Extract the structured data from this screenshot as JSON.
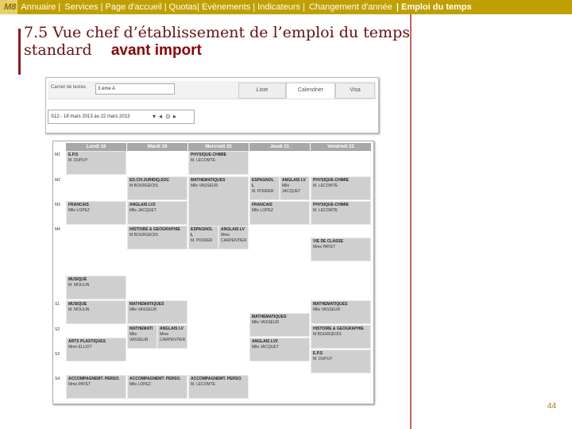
{
  "nav": {
    "badge": "M8",
    "items": [
      "Annuaire |",
      "Services | Page d'accueil | Quotas| Evènements | Indicateurs |",
      "Changement d'année",
      "| Emploi du temps"
    ]
  },
  "title": {
    "line1": "7.5 Vue chef d’établissement de l’emploi du temps",
    "line2": "standard",
    "highlight": "avant import"
  },
  "screenshot1": {
    "label": "Carnet de textes",
    "select": "3 ème A",
    "tabs": [
      "Liste",
      "Calendrier",
      "Visa"
    ],
    "active_tab": "Calendrier",
    "week": "S12 - 18 mars 2013 au 22 mars 2013"
  },
  "screenshot2": {
    "days": [
      "Lundi 18",
      "Mardi 19",
      "Mercredi 20",
      "Jeudi 21",
      "Vendredi 22"
    ],
    "hours": [
      "M1",
      "M2",
      "M3",
      "M4",
      "S1",
      "S2",
      "S3",
      "S4"
    ],
    "cells": [
      {
        "subject": "E.P.S",
        "teacher": "M. DUPUY"
      },
      {
        "subject": "PHYSIQUE-CHIMIE",
        "teacher": "M. LECOMTE"
      },
      {
        "subject": "ED.CIV.JURIDIQ.SOC",
        "teacher": "M BOURGEOIS"
      },
      {
        "subject": "MATHEMATIQUES",
        "teacher": "Mlle VASSEUR"
      },
      {
        "subject": "ESPAGNOL L",
        "teacher": "M. POIRIER"
      },
      {
        "subject": "ANGLAIS LV",
        "teacher": "Mlle JACQUET"
      },
      {
        "subject": "PHYSIQUE-CHIMIE",
        "teacher": "M. LECOMTE"
      },
      {
        "subject": "FRANCAIS",
        "teacher": "Mlle LOPEZ"
      },
      {
        "subject": "ANGLAIS LV2",
        "teacher": "Mlle JACQUET"
      },
      {
        "subject": "FRANCAIS",
        "teacher": "Mlle LOPEZ"
      },
      {
        "subject": "PHYSIQUE-CHIMIE",
        "teacher": "M. LECOMTE"
      },
      {
        "subject": "HISTOIRE & GEOGRAPHIE",
        "teacher": "M BOURGEOIS"
      },
      {
        "subject": "ESPAGNOL L",
        "teacher": "M. POIRIER"
      },
      {
        "subject": "ANGLAIS LV",
        "teacher": "Mme CARPENTIER"
      },
      {
        "subject": "VIE DE CLASSE",
        "teacher": "Mme PAYET"
      },
      {
        "subject": "MUSIQUE",
        "teacher": "M. MOULIN"
      },
      {
        "subject": "MUSIQUE",
        "teacher": "M. MOULIN"
      },
      {
        "subject": "MATHEMATIQUES",
        "teacher": "Mlle VASSEUR"
      },
      {
        "subject": "MATHEMATIQUES",
        "teacher": "Mlle VASSEUR"
      },
      {
        "subject": "MATHEMATIQUES",
        "teacher": "Mlle VASSEUR"
      },
      {
        "subject": "ARTS PLASTIQUES",
        "teacher": "Mme ELLIOT"
      },
      {
        "subject": "MATHEMATI",
        "teacher": "Mlle VASSEUR"
      },
      {
        "subject": "ANGLAIS LV",
        "teacher": "Mme CARPENTIER"
      },
      {
        "subject": "HISTOIRE & GEOGRAPHIE",
        "teacher": "M BOURGEOIS"
      },
      {
        "subject": "ANGLAIS LV2",
        "teacher": "Mlle JACQUET"
      },
      {
        "subject": "E.P.S",
        "teacher": "M. DUPUY"
      },
      {
        "subject": "ACCOMPAGNEMT. PERSO.",
        "teacher": "Mme PAYET"
      },
      {
        "subject": "ACCOMPAGNEMT. PERSO.",
        "teacher": "Mlle LOPEZ"
      },
      {
        "subject": "ACCOMPAGNEMT. PERSO.",
        "teacher": "M. LECOMTE"
      }
    ]
  },
  "page_number": "44"
}
